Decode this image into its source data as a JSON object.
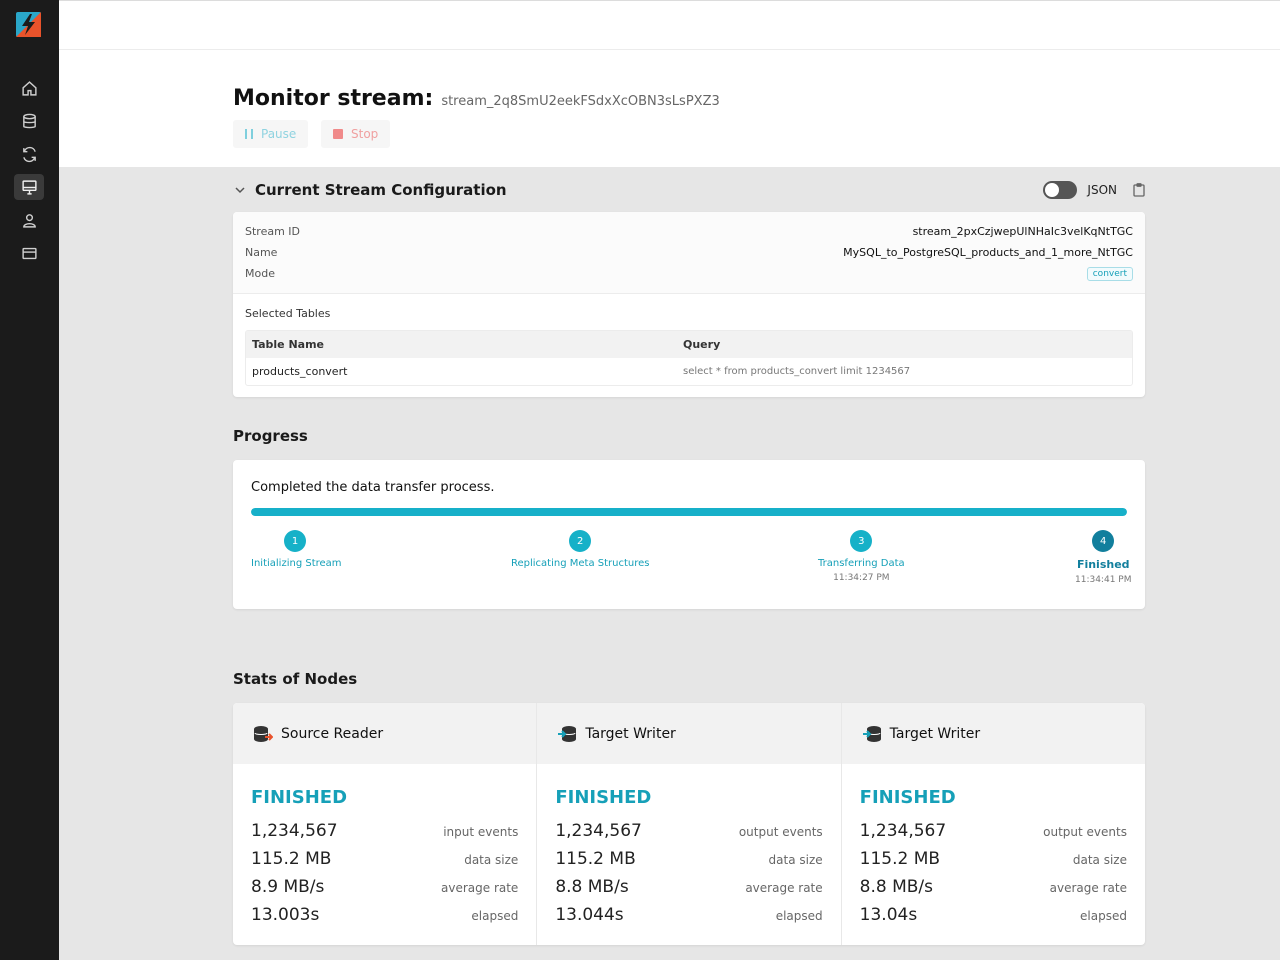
{
  "page": {
    "title": "Monitor stream:",
    "stream_id": "stream_2q8SmU2eekFSdxXcOBN3sLsPXZ3",
    "pause_label": "Pause",
    "stop_label": "Stop"
  },
  "sidebar": {
    "items": [
      {
        "icon": "home-icon"
      },
      {
        "icon": "database-icon"
      },
      {
        "icon": "sync-icon"
      },
      {
        "icon": "monitor-icon",
        "active": true
      },
      {
        "icon": "user-icon"
      },
      {
        "icon": "card-icon"
      }
    ]
  },
  "config": {
    "title": "Current Stream Configuration",
    "json_label": "JSON",
    "rows": [
      {
        "key": "Stream ID",
        "value": "stream_2pxCzjwepUlNHaIc3velKqNtTGC"
      },
      {
        "key": "Name",
        "value": "MySQL_to_PostgreSQL_products_and_1_more_NtTGC"
      },
      {
        "key": "Mode",
        "value": "convert"
      }
    ],
    "selected_tables_label": "Selected Tables",
    "table": {
      "headers": [
        "Table Name",
        "Query"
      ],
      "rows": [
        [
          "products_convert",
          "select * from products_convert limit 1234567"
        ]
      ]
    }
  },
  "progress": {
    "title": "Progress",
    "message": "Completed the data transfer process.",
    "fraction": 1.0,
    "steps": [
      {
        "num": "1",
        "label": "Initializing Stream",
        "time": ""
      },
      {
        "num": "2",
        "label": "Replicating Meta Structures",
        "time": ""
      },
      {
        "num": "3",
        "label": "Transferring Data",
        "time": "11:34:27 PM"
      },
      {
        "num": "4",
        "label": "Finished",
        "time": "11:34:41 PM"
      }
    ]
  },
  "stats": {
    "title": "Stats of Nodes",
    "nodes": [
      {
        "title": "Source Reader",
        "status": "FINISHED",
        "metrics": [
          {
            "value": "1,234,567",
            "label": "input events"
          },
          {
            "value": "115.2 MB",
            "label": "data size"
          },
          {
            "value": "8.9 MB/s",
            "label": "average rate"
          },
          {
            "value": "13.003s",
            "label": "elapsed"
          }
        ]
      },
      {
        "title": "Target Writer",
        "status": "FINISHED",
        "metrics": [
          {
            "value": "1,234,567",
            "label": "output events"
          },
          {
            "value": "115.2 MB",
            "label": "data size"
          },
          {
            "value": "8.8 MB/s",
            "label": "average rate"
          },
          {
            "value": "13.044s",
            "label": "elapsed"
          }
        ]
      },
      {
        "title": "Target Writer",
        "status": "FINISHED",
        "metrics": [
          {
            "value": "1,234,567",
            "label": "output events"
          },
          {
            "value": "115.2 MB",
            "label": "data size"
          },
          {
            "value": "8.8 MB/s",
            "label": "average rate"
          },
          {
            "value": "13.04s",
            "label": "elapsed"
          }
        ]
      }
    ]
  },
  "colors": {
    "accent": "#16b1c8",
    "accent_dark": "#127f9d",
    "sidebar": "#1b1b1b",
    "stop": "#f08a8a"
  }
}
